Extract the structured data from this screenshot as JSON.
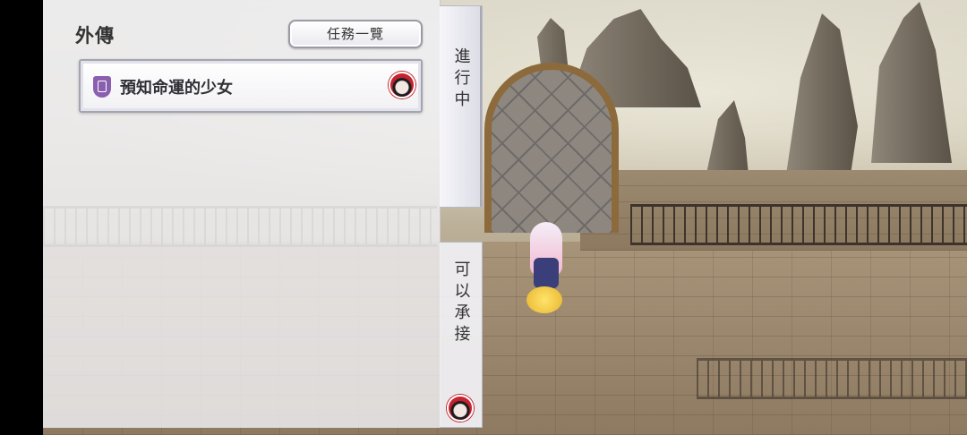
{
  "panel": {
    "title": "外傳",
    "quest_list_button": "任務一覽",
    "quests": [
      {
        "name": "預知命運的少女",
        "badge_icon": "quest-shield-icon",
        "avatar_icon": "red-mascot-avatar-icon"
      }
    ]
  },
  "tabs": [
    {
      "label": "進行中",
      "state": "active"
    },
    {
      "label": "可以承接",
      "state": "inactive"
    }
  ],
  "colors": {
    "badge": "#8a5fb0",
    "avatar_ring": "#c5232e",
    "panel_bg": "#f0f0f4"
  }
}
